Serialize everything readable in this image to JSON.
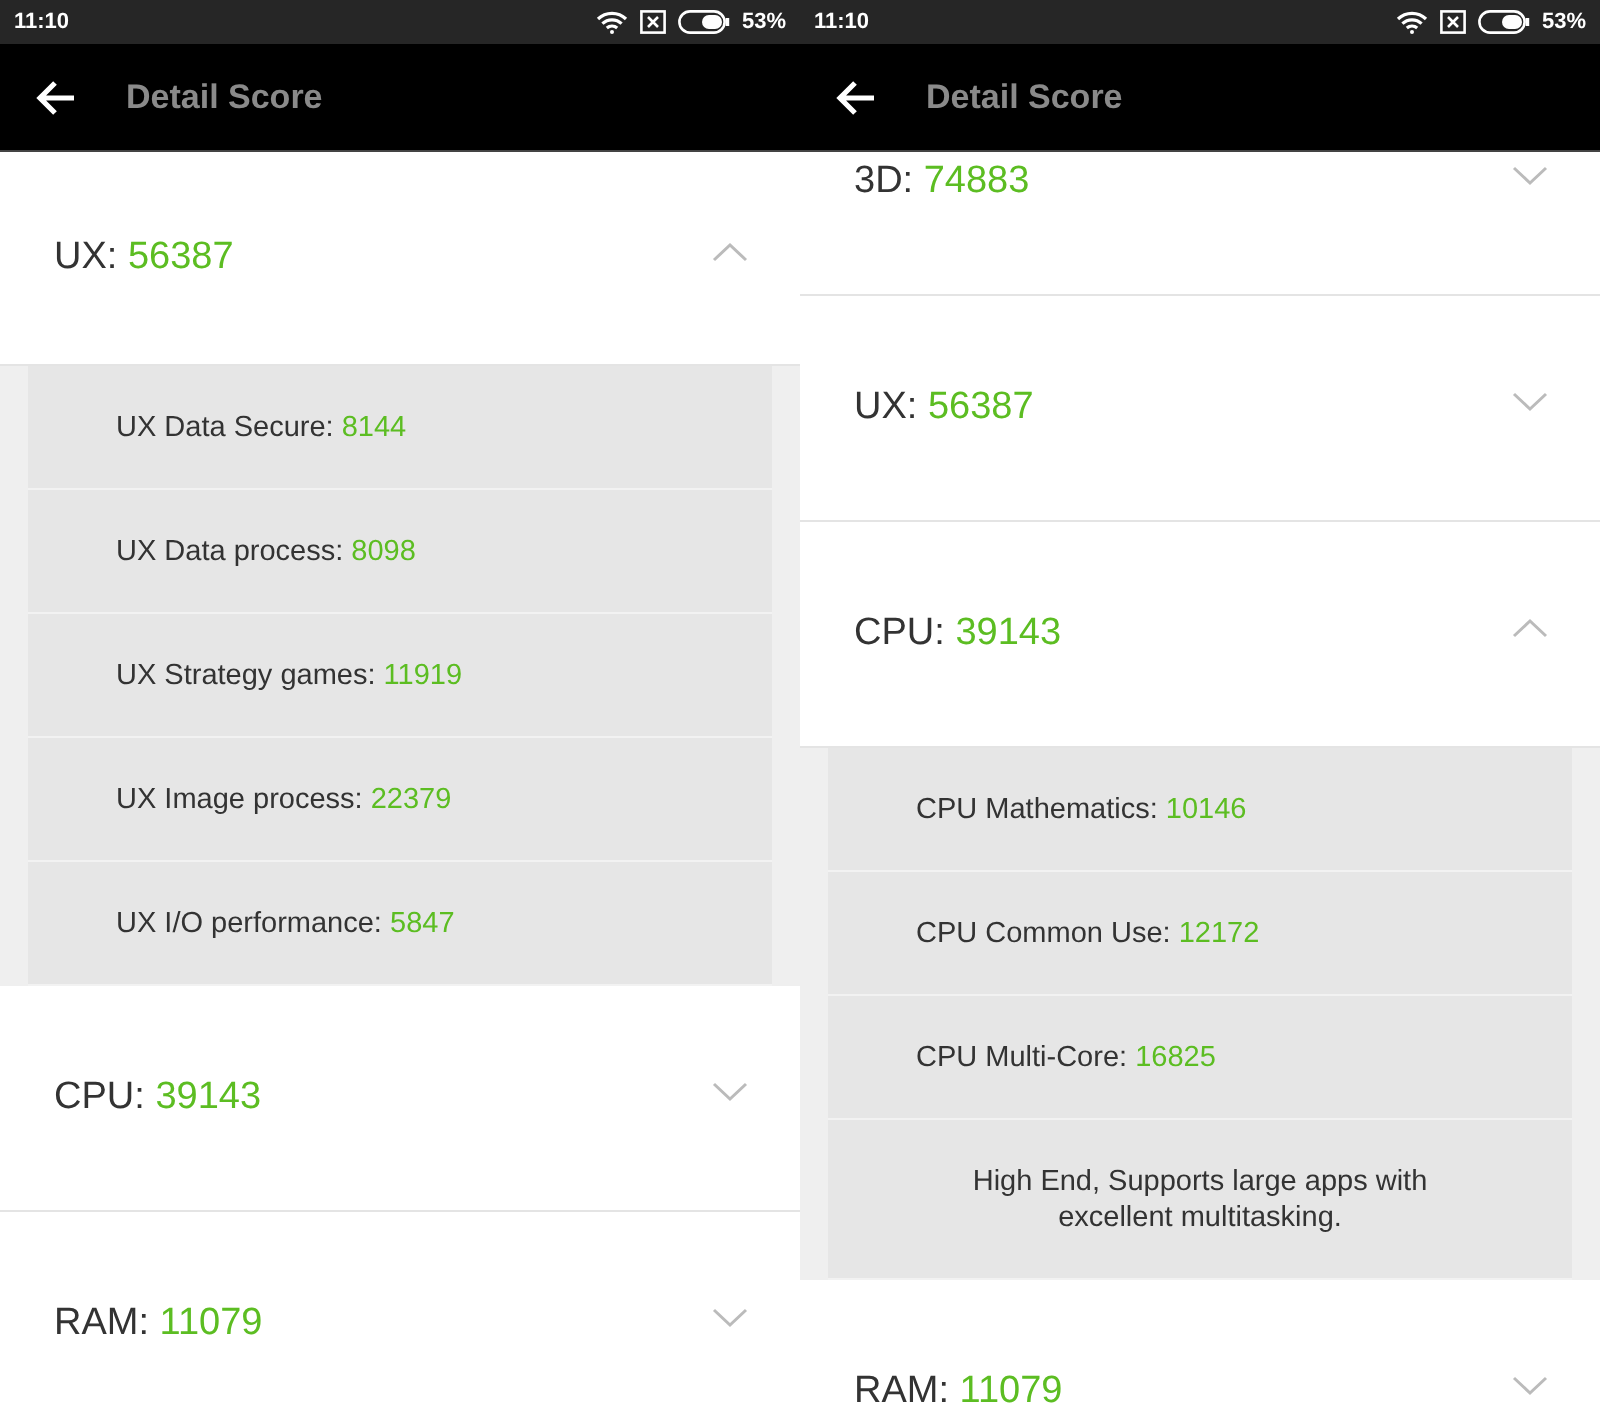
{
  "screens": [
    {
      "status_bar": {
        "time": "11:10",
        "battery": "53%"
      },
      "toolbar": {
        "title": "Detail Score"
      },
      "scrolled": false,
      "sections": [
        {
          "label": "UX:",
          "score": "56387",
          "expanded": true,
          "items": [
            {
              "label": "UX Data Secure:",
              "score": "8144"
            },
            {
              "label": "UX Data process:",
              "score": "8098"
            },
            {
              "label": "UX Strategy games:",
              "score": "11919"
            },
            {
              "label": "UX Image process:",
              "score": "22379"
            },
            {
              "label": "UX I/O performance:",
              "score": "5847"
            }
          ]
        },
        {
          "label": "CPU:",
          "score": "39143",
          "expanded": false
        },
        {
          "label": "RAM:",
          "score": "11079",
          "expanded": false
        }
      ]
    },
    {
      "status_bar": {
        "time": "11:10",
        "battery": "53%"
      },
      "toolbar": {
        "title": "Detail Score"
      },
      "scrolled": true,
      "sections": [
        {
          "label": "3D:",
          "score": "74883",
          "expanded": false
        },
        {
          "label": "UX:",
          "score": "56387",
          "expanded": false
        },
        {
          "label": "CPU:",
          "score": "39143",
          "expanded": true,
          "items": [
            {
              "label": "CPU Mathematics:",
              "score": "10146"
            },
            {
              "label": "CPU Common Use:",
              "score": "12172"
            },
            {
              "label": "CPU Multi-Core:",
              "score": "16825"
            }
          ],
          "summary": "High End, Supports large apps with excellent multitasking."
        },
        {
          "label": "RAM:",
          "score": "11079",
          "expanded": false
        }
      ]
    }
  ]
}
